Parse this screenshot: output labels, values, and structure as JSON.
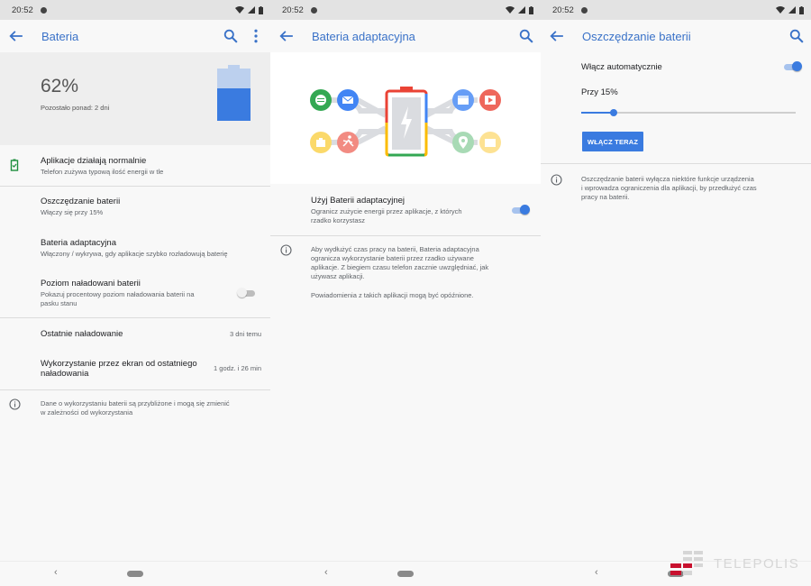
{
  "status": {
    "time": "20:52"
  },
  "screen1": {
    "title": "Bateria",
    "header": {
      "percent": "62%",
      "remaining": "Pozostało ponad: 2 dni",
      "level": 0.62
    },
    "status_row": {
      "title": "Aplikacje działają normalnie",
      "subtitle": "Telefon zużywa typową ilość energii w tle"
    },
    "saver_row": {
      "title": "Oszczędzanie baterii",
      "subtitle": "Włączy się przy 15%"
    },
    "adaptive_row": {
      "title": "Bateria adaptacyjna",
      "subtitle": "Włączony / wykrywa, gdy aplikacje szybko rozładowują baterię"
    },
    "percent_row": {
      "title": "Poziom naładowani baterii",
      "subtitle_line1": "Pokazuj procentowy poziom naładowania baterii na",
      "subtitle_line2": "pasku stanu",
      "enabled": false
    },
    "last_charge_row": {
      "title": "Ostatnie naładowanie",
      "value": "3 dni temu"
    },
    "screen_usage_row": {
      "title_line1": "Wykorzystanie przez ekran od ostatniego",
      "title_line2": "naładowania",
      "value": "1 godz. i 26 min"
    },
    "info": {
      "line1": "Dane o wykorzystaniu baterii są przybliżone i mogą się zmienić",
      "line2": "w zależności od wykorzystania"
    }
  },
  "screen2": {
    "title": "Bateria adaptacyjna",
    "toggle_row": {
      "title": "Użyj Baterii adaptacyjnej",
      "subtitle_line1": "Ogranicz zużycie energii przez aplikacje, z których",
      "subtitle_line2": "rzadko korzystasz",
      "enabled": true
    },
    "info": {
      "line1": "Aby wydłużyć czas pracy na baterii, Bateria adaptacyjna",
      "line2": "ogranicza wykorzystanie baterii przez rzadko używane",
      "line3": "aplikacje. Z biegiem czasu telefon zacznie uwzględniać, jak",
      "line4": "używasz aplikacji.",
      "line5": "Powiadomienia z takich aplikacji mogą być opóźnione."
    }
  },
  "screen3": {
    "title": "Oszczędzanie baterii",
    "auto_row": {
      "title": "Włącz automatycznie",
      "enabled": true
    },
    "threshold": {
      "label": "Przy 15%",
      "value_fraction": 0.15
    },
    "button_label": "WŁĄCZ TERAZ",
    "info": {
      "line1": "Oszczędzanie baterii wyłącza niektóre funkcje urządzenia",
      "line2": "i wprowadza ograniczenia dla aplikacji, by przedłużyć czas",
      "line3": "pracy na baterii."
    }
  },
  "watermark": {
    "text": "TELEPOLIS"
  },
  "colors": {
    "accent": "#3a7be0",
    "title_blue": "#3a72c8",
    "battery_green": "#1e8e3e"
  }
}
